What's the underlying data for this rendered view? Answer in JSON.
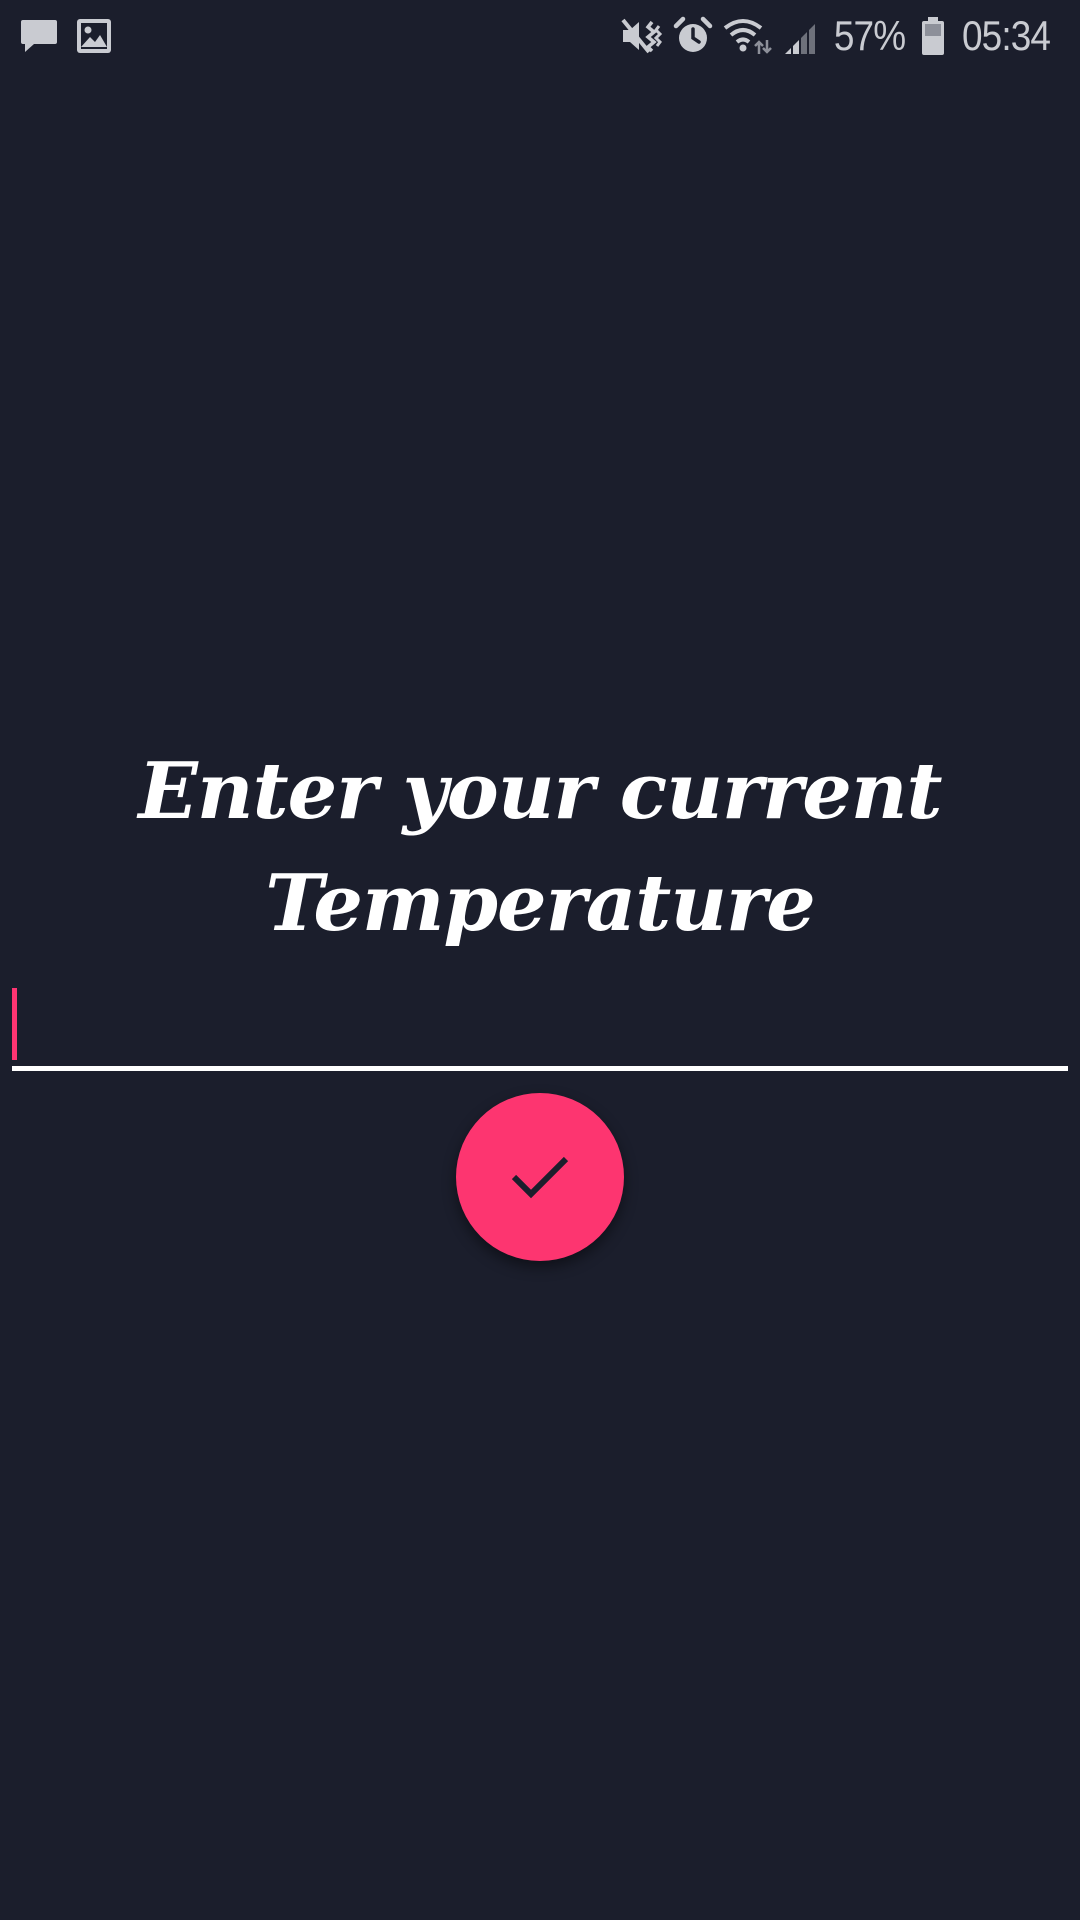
{
  "status_bar": {
    "left_icons": [
      "message-icon",
      "image-icon"
    ],
    "right_icons": [
      "mute-vibrate-icon",
      "alarm-icon",
      "wifi-icon",
      "signal-icon",
      "battery-icon"
    ],
    "battery_percent": "57%",
    "time": "05:34"
  },
  "main": {
    "title_line1": "Enter your current",
    "title_line2": "Temperature",
    "temperature_input": {
      "value": "",
      "placeholder": ""
    },
    "submit_icon": "check-icon"
  },
  "colors": {
    "background": "#1b1e2c",
    "accent": "#fd3570",
    "text": "#ffffff",
    "status_icons": "#c9cbd1"
  }
}
